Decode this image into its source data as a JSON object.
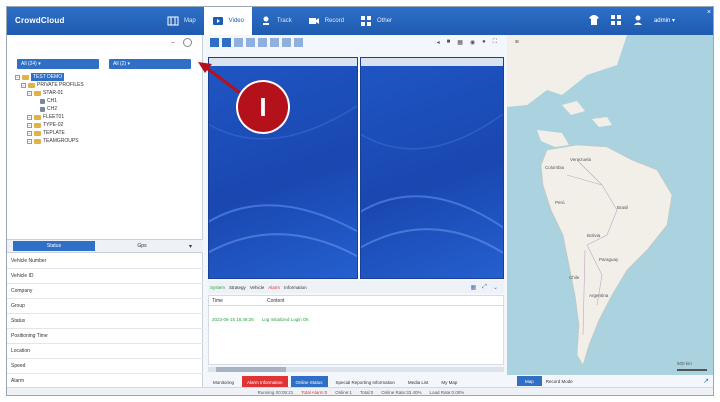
{
  "app": {
    "title": "CrowdCloud"
  },
  "nav": [
    {
      "label": "Map",
      "icon": "map-icon",
      "active": false
    },
    {
      "label": "Video",
      "icon": "video-icon",
      "active": true
    },
    {
      "label": "Track",
      "icon": "track-icon",
      "active": false
    },
    {
      "label": "Record",
      "icon": "record-icon",
      "active": false
    },
    {
      "label": "Other",
      "icon": "grid-icon",
      "active": false
    }
  ],
  "topbar_right": {
    "user_label": "admin ▾"
  },
  "left": {
    "tools": {
      "minus": "–",
      "refresh_icon": "refresh-icon"
    },
    "filters": [
      {
        "label": "All (24) ▾"
      },
      {
        "label": "All (2) ▾"
      }
    ],
    "tree": [
      {
        "label": "TEST DEMO",
        "level": 0,
        "kind": "root",
        "selected": true
      },
      {
        "label": "PRIVATE PROFILES",
        "level": 1,
        "kind": "folder"
      },
      {
        "label": "STAR-01",
        "level": 2,
        "kind": "folder"
      },
      {
        "label": "CH1",
        "level": 3,
        "kind": "cam"
      },
      {
        "label": "CH2",
        "level": 3,
        "kind": "cam"
      },
      {
        "label": "FLEET01",
        "level": 2,
        "kind": "folder"
      },
      {
        "label": "TYPE-02",
        "level": 2,
        "kind": "folder"
      },
      {
        "label": "TEPLATE",
        "level": 2,
        "kind": "folder"
      },
      {
        "label": "TEAMGROUPS",
        "level": 2,
        "kind": "folder"
      }
    ],
    "info_tabs": [
      {
        "label": "Status"
      },
      {
        "label": "Gps"
      }
    ],
    "info_rows": [
      "Vehicle Number",
      "Vehicle ID",
      "Company",
      "Group",
      "Status",
      "Positioning Time",
      "Location",
      "Speed",
      "Alarm"
    ]
  },
  "center": {
    "pane_left_title": "",
    "pane_right_title": "",
    "log_toolbar": {
      "g1": "System",
      "t1": "Strategy",
      "t2": "Vehicle",
      "r1": "Alarm",
      "t3": "Information"
    },
    "log_head": {
      "time": "Time",
      "content": "Content"
    },
    "log_rows": [
      {
        "time": "2023-06-15 15:48:26",
        "content": "Log Initialized Login Ok"
      }
    ],
    "bottom_tabs": [
      {
        "label": "Monitoring",
        "style": "plain"
      },
      {
        "label": "Alarm Information",
        "style": "red"
      },
      {
        "label": "Online Status",
        "style": "blue"
      },
      {
        "label": "Special Reporting Information",
        "style": "plain"
      },
      {
        "label": "Media List",
        "style": "plain"
      },
      {
        "label": "My Map",
        "style": "plain"
      }
    ]
  },
  "map": {
    "labels": {
      "brazil": "Brasil",
      "peru": "Perú",
      "bolivia": "Bolivia",
      "paraguay": "Paraguay",
      "chile": "Chile",
      "argentina": "Argentina",
      "colombia": "Colombia",
      "venezuela": "Venezuela"
    },
    "tabs": [
      {
        "label": "Map",
        "active": true
      },
      {
        "label": "Record Mode",
        "active": false
      }
    ],
    "scale": "500 km"
  },
  "status": {
    "running": "Running 00:05:21",
    "alarm": "Total Alarm:0",
    "online": "Online:1",
    "total": "Total:0",
    "online_rate": "Online Rate:33.40%",
    "load_rate": "Load Rate:0.00%"
  },
  "annotation": {
    "marker": "I"
  }
}
